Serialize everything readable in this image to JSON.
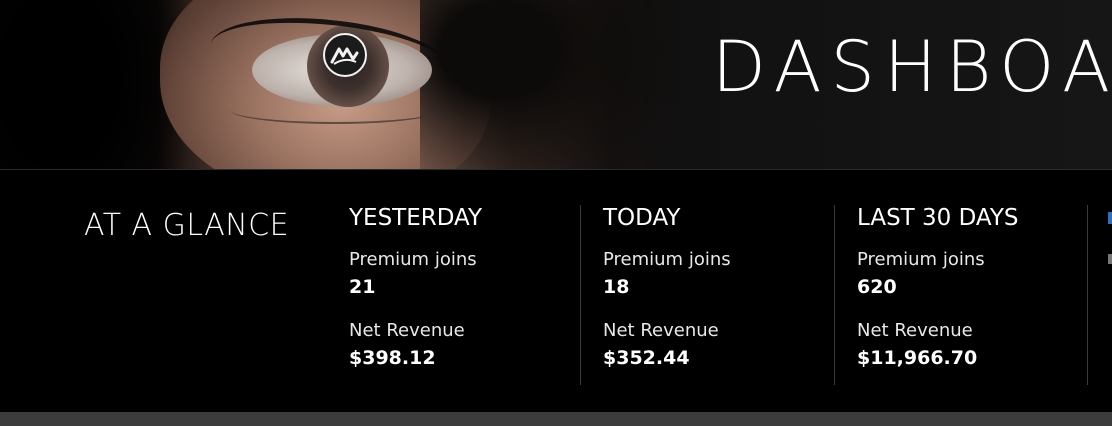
{
  "header": {
    "title": "DASHBOA"
  },
  "glance": {
    "title": "AT A GLANCE"
  },
  "stats": [
    {
      "period": "YESTERDAY",
      "joins_label": "Premium joins",
      "joins": "21",
      "revenue_label": "Net Revenue",
      "revenue": "$398.12"
    },
    {
      "period": "TODAY",
      "joins_label": "Premium joins",
      "joins": "18",
      "revenue_label": "Net Revenue",
      "revenue": "$352.44"
    },
    {
      "period": "LAST 30 DAYS",
      "joins_label": "Premium joins",
      "joins": "620",
      "revenue_label": "Net Revenue",
      "revenue": "$11,966.70"
    }
  ],
  "icons": {
    "logo": "brand-logo-icon"
  },
  "colors": {
    "background": "#000000",
    "text": "#ffffff",
    "divider": "#3a3a3a",
    "footer": "#3c3c3c"
  }
}
